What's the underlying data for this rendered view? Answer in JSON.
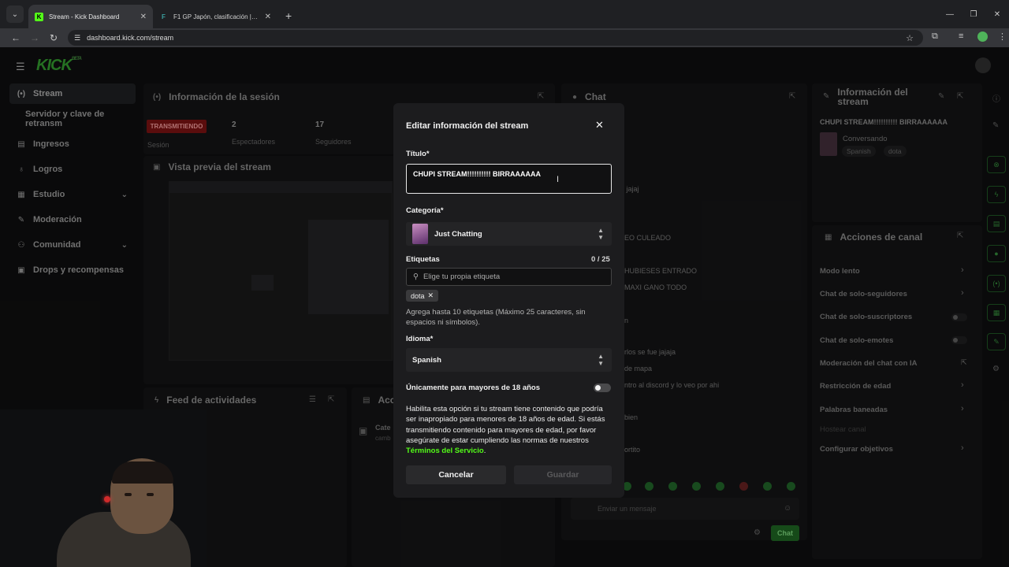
{
  "browser": {
    "tabs": [
      {
        "title": "Stream - Kick Dashboard",
        "favicon": "K"
      },
      {
        "title": "F1 GP Japón, clasificación | Co...",
        "favicon": "F"
      }
    ],
    "url": "dashboard.kick.com/stream"
  },
  "brand": {
    "logo": "KICK",
    "badge": "BETA",
    "accent": "#53fc18"
  },
  "sidebar": {
    "items": [
      {
        "label": "Stream",
        "icon": "broadcast-icon"
      },
      {
        "label": "Servidor y clave de retransm"
      },
      {
        "label": "Ingresos",
        "icon": "dollar-icon"
      },
      {
        "label": "Logros",
        "icon": "trophy-icon"
      },
      {
        "label": "Estudio",
        "icon": "studio-icon"
      },
      {
        "label": "Moderación",
        "icon": "wrench-icon"
      },
      {
        "label": "Comunidad",
        "icon": "users-icon"
      },
      {
        "label": "Drops y recompensas",
        "icon": "gift-icon"
      }
    ]
  },
  "session": {
    "title": "Información de la sesión",
    "status": "TRANSMITIENDO",
    "status_label": "Sesión",
    "viewers": "2",
    "viewers_label": "Espectadores",
    "followers": "17",
    "followers_label": "Seguidores"
  },
  "preview": {
    "title": "Vista previa del stream"
  },
  "feed": {
    "title": "Feed de actividades",
    "side_title": "Acc",
    "side_item": "Cate",
    "side_sub": "camb"
  },
  "chat": {
    "title": "Chat",
    "lines": [
      "l jajaj",
      "EO CULEADO",
      "HUBIESES ENTRADO",
      "MAXI GANO TODO",
      "n",
      "rlos se fue jajaja",
      "de mapa",
      "ntro al discord y lo veo por ahi",
      "bien",
      "ortito"
    ],
    "input_placeholder": "Enviar un mensaje",
    "send_label": "Chat"
  },
  "stream_info": {
    "title": "Información del stream",
    "stream_title": "CHUPI STREAM!!!!!!!!!! BIRRAAAAAA",
    "category": "Conversando",
    "tags": [
      "Spanish",
      "dota"
    ]
  },
  "channel_actions": {
    "title": "Acciones de canal",
    "items": [
      {
        "label": "Modo lento",
        "control": "arrow"
      },
      {
        "label": "Chat de solo-seguidores",
        "control": "arrow"
      },
      {
        "label": "Chat de solo-suscriptores",
        "control": "toggle"
      },
      {
        "label": "Chat de solo-emotes",
        "control": "toggle"
      },
      {
        "label": "Moderación del chat con IA",
        "control": "external"
      },
      {
        "label": "Restricción de edad",
        "control": "arrow"
      },
      {
        "label": "Palabras baneadas",
        "control": "arrow"
      },
      {
        "label": "Hostear canal",
        "control": "none"
      },
      {
        "label": "Configurar objetivos",
        "control": "arrow"
      }
    ]
  },
  "modal": {
    "title": "Editar información del stream",
    "title_label": "Título*",
    "title_value": "CHUPI STREAM!!!!!!!!!! BIRRAAAAAA",
    "category_label": "Categoría*",
    "category_value": "Just Chatting",
    "tags_label": "Etiquetas",
    "tags_count": "0 / 25",
    "tags_placeholder": "Elige tu propia etiqueta",
    "tag": "dota",
    "tags_help": "Agrega hasta 10 etiquetas (Máximo 25 caracteres, sin espacios ni símbolos).",
    "language_label": "Idioma*",
    "language_value": "Spanish",
    "adult_label": "Únicamente para mayores de 18 años",
    "adult_enabled": false,
    "adult_desc": "Habilita esta opción si tu stream tiene contenido que podría ser inapropiado para menores de 18 años de edad. Si estás transmitiendo contenido para mayores de edad, por favor asegúrate de estar cumpliendo las normas de nuestros",
    "adult_link": "Términos del Servicio",
    "adult_end": ".",
    "cancel_label": "Cancelar",
    "save_label": "Guardar"
  }
}
